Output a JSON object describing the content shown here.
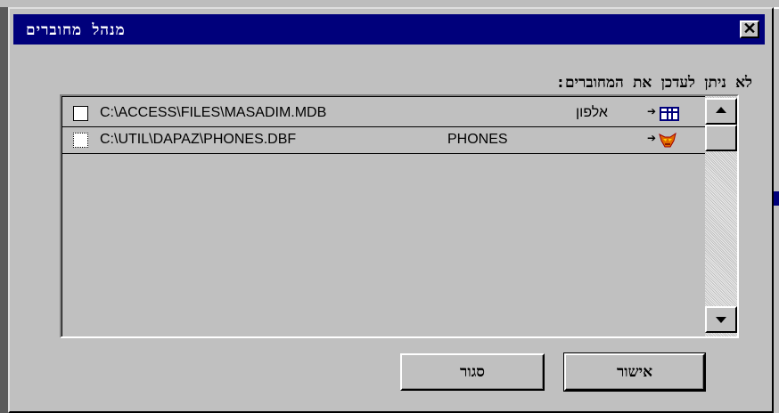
{
  "window": {
    "title": "מנהל מחוברים",
    "close_glyph": "✕"
  },
  "list": {
    "label": "לא ניתן לעדכן את המחוברים:",
    "rows": [
      {
        "checked": false,
        "path": "C:\\ACCESS\\FILES\\MASADIM.MDB",
        "name": "אלפון",
        "icon": "access-table-icon",
        "arrow": "➔"
      },
      {
        "checked": false,
        "path": "C:\\UTIL\\DAPAZ\\PHONES.DBF",
        "name": "PHONES",
        "icon": "foxpro-table-icon",
        "arrow": "➔"
      }
    ]
  },
  "buttons": {
    "ok": "אישור",
    "close": "סגור"
  },
  "colors": {
    "titlebar": "#00007b",
    "face": "#c0c0c0"
  }
}
